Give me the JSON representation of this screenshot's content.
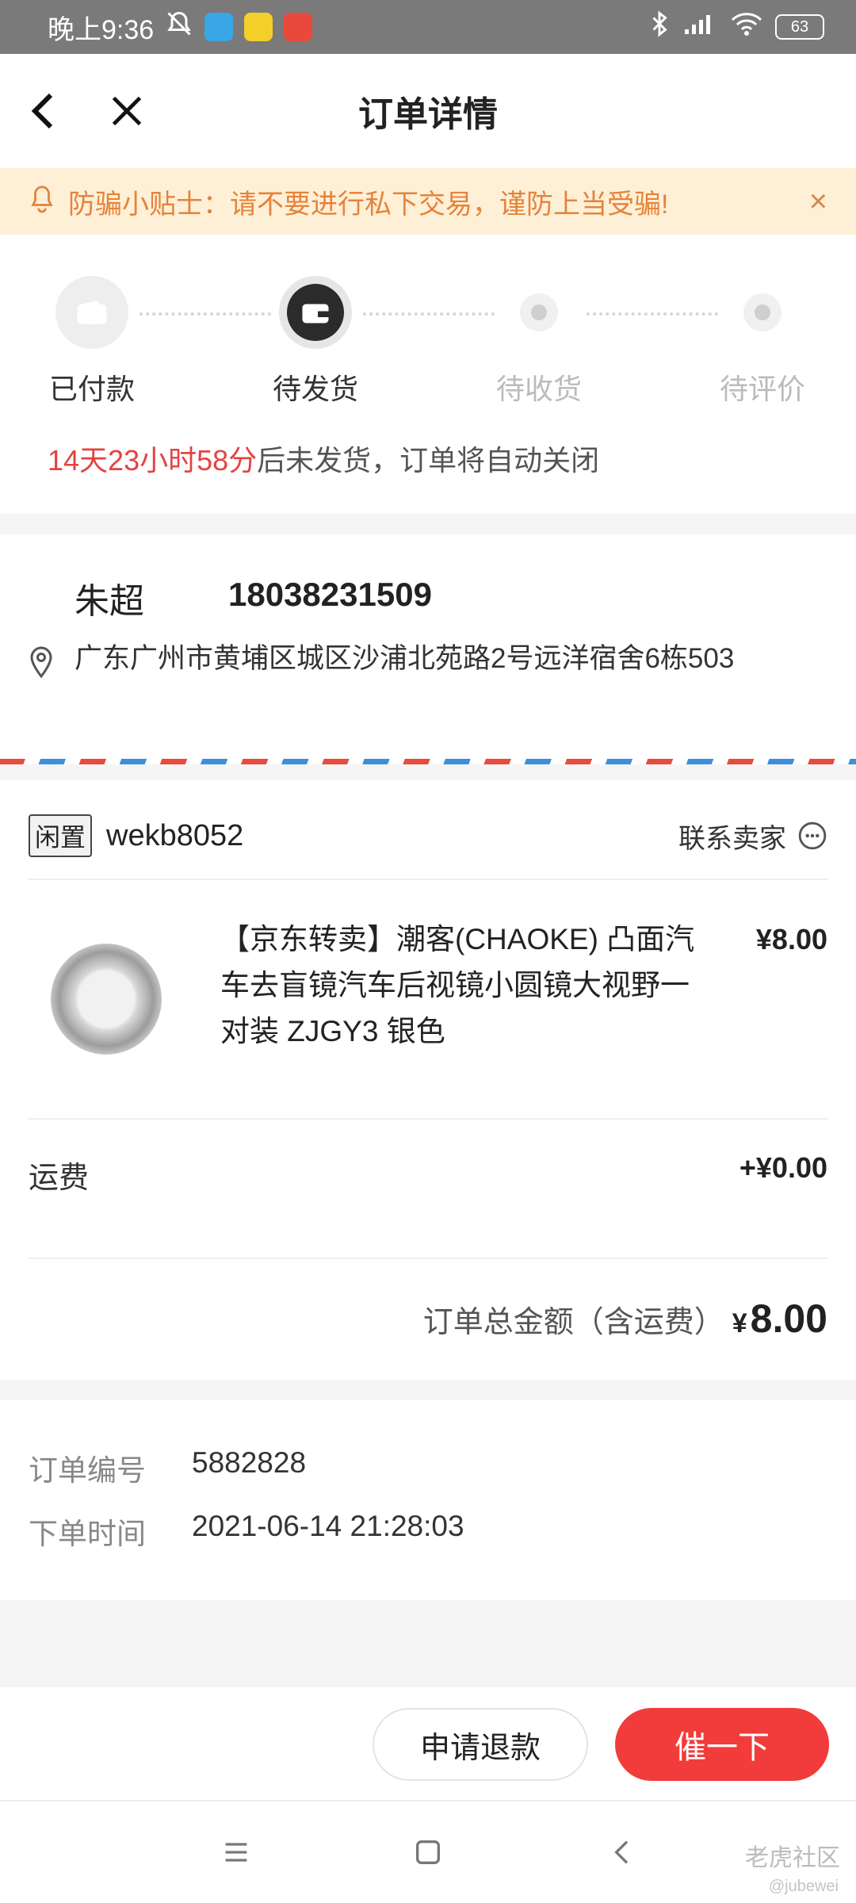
{
  "status_bar": {
    "time": "晚上9:36",
    "battery": "63"
  },
  "header": {
    "title": "订单详情"
  },
  "notice": {
    "text": "防骗小贴士：请不要进行私下交易，谨防上当受骗!",
    "close": "×"
  },
  "progress": {
    "steps": [
      {
        "label": "已付款",
        "state": "done"
      },
      {
        "label": "待发货",
        "state": "current"
      },
      {
        "label": "待收货",
        "state": "pending"
      },
      {
        "label": "待评价",
        "state": "pending"
      }
    ],
    "countdown_time": "14天23小时58分",
    "countdown_text": "后未发货，订单将自动关闭"
  },
  "address": {
    "name": "朱超",
    "phone": "18038231509",
    "line": "广东广州市黄埔区城区沙浦北苑路2号远洋宿舍6栋503"
  },
  "order": {
    "shop_tag": "闲置",
    "shop_name": "wekb8052",
    "contact": "联系卖家",
    "product_title": "【京东转卖】潮客(CHAOKE) 凸面汽车去盲镜汽车后视镜小圆镜大视野一对装 ZJGY3 银色",
    "product_price": "¥8.00",
    "shipping_label": "运费",
    "shipping_value": "+¥0.00",
    "total_label": "订单总金额（含运费）",
    "total_currency": "¥",
    "total_amount": "8.00"
  },
  "order_info": {
    "number_label": "订单编号",
    "number_value": "5882828",
    "time_label": "下单时间",
    "time_value": "2021-06-14 21:28:03"
  },
  "actions": {
    "refund": "申请退款",
    "urge": "催一下"
  },
  "watermark": {
    "brand": "老虎社区",
    "user": "@jubewei"
  },
  "colors": {
    "accent_red": "#f23b3b",
    "countdown_red": "#e44242",
    "notice_bg": "#fdf0d7",
    "notice_text": "#e6833a"
  }
}
